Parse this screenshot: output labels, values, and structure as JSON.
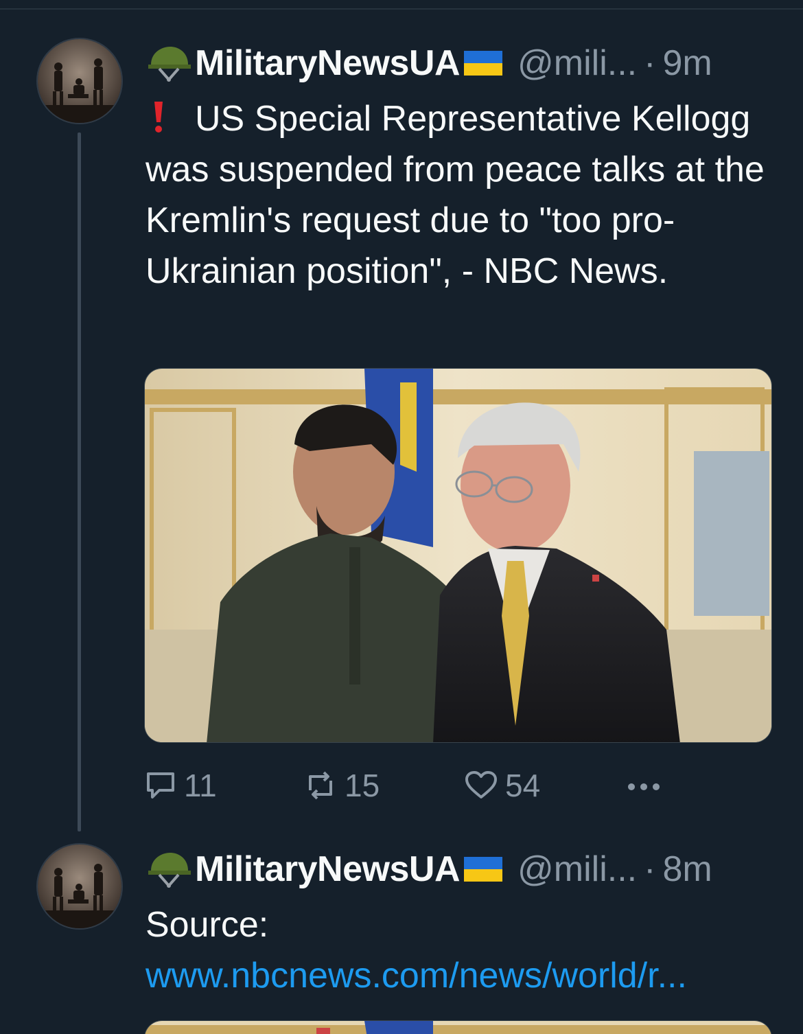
{
  "tweets": [
    {
      "display_name": "MilitaryNewsUA",
      "handle": "@mili...",
      "separator": "·",
      "time": "9m",
      "text": "US Special Representative Kellogg was suspended from peace talks at the Kremlin's request due to \"too pro-Ukrainian position\", - NBC News.",
      "emoji_prefix": "red-exclamation-icon",
      "media_description_icon": "photo",
      "actions": {
        "replies": "11",
        "retweets": "15",
        "likes": "54"
      }
    },
    {
      "display_name": "MilitaryNewsUA",
      "handle": "@mili...",
      "separator": "·",
      "time": "8m",
      "text_prefix": "Source: ",
      "link_text": "www.nbcnews.com/news/world/r..."
    }
  ],
  "colors": {
    "background": "#15202b",
    "text": "#f7f9f9",
    "secondary": "#8b98a5",
    "link": "#1d9bf0",
    "thread_line": "#3d4a58"
  },
  "icons": {
    "name_prefix": "helmet-icon",
    "name_suffix": "ukraine-flag-icon",
    "reply": "reply-icon",
    "retweet": "retweet-icon",
    "like": "heart-icon",
    "more": "more-dots-icon"
  }
}
